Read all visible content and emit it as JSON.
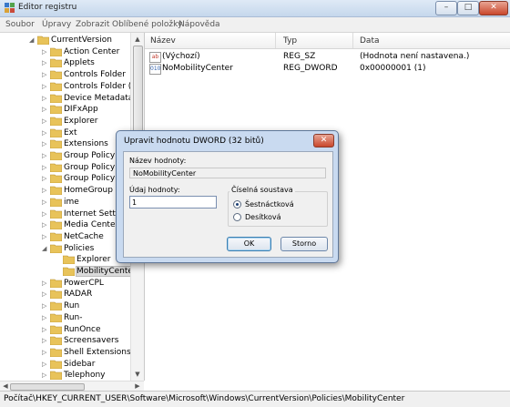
{
  "window": {
    "title": "Editor registru",
    "minimize": "–",
    "maximize": "□",
    "close": "✕"
  },
  "menu": [
    "Soubor",
    "Úpravy",
    "Zobrazit",
    "Oblíbené položky",
    "Nápověda"
  ],
  "tree": {
    "items": [
      {
        "label": "CurrentVersion",
        "expanded": true
      },
      {
        "label": "Action Center"
      },
      {
        "label": "Applets"
      },
      {
        "label": "Controls Folder"
      },
      {
        "label": "Controls Folder (Wo"
      },
      {
        "label": "Device Metadata"
      },
      {
        "label": "DIFxApp"
      },
      {
        "label": "Explorer"
      },
      {
        "label": "Ext"
      },
      {
        "label": "Extensions"
      },
      {
        "label": "Group Policy"
      },
      {
        "label": "Group Policy Ed"
      },
      {
        "label": "Group Policy Ob"
      },
      {
        "label": "HomeGroup"
      },
      {
        "label": "ime"
      },
      {
        "label": "Internet Settings"
      },
      {
        "label": "Media Center"
      },
      {
        "label": "NetCache"
      },
      {
        "label": "Policies",
        "expanded": true
      },
      {
        "label": "Explorer"
      },
      {
        "label": "MobilityCenter",
        "selected": true
      },
      {
        "label": "PowerCPL"
      },
      {
        "label": "RADAR"
      },
      {
        "label": "Run"
      },
      {
        "label": "Run-"
      },
      {
        "label": "RunOnce"
      },
      {
        "label": "Screensavers"
      },
      {
        "label": "Shell Extensions"
      },
      {
        "label": "Sidebar"
      },
      {
        "label": "Telephony"
      }
    ]
  },
  "list": {
    "columns": [
      "Název",
      "Typ",
      "Data"
    ],
    "rows": [
      {
        "icon": "string-value-icon",
        "icon_text": "ab",
        "name": "(Výchozí)",
        "type": "REG_SZ",
        "data": "(Hodnota není nastavena.)"
      },
      {
        "icon": "binary-value-icon",
        "icon_text": "010",
        "name": "NoMobilityCenter",
        "type": "REG_DWORD",
        "data": "0x00000001 (1)"
      }
    ]
  },
  "dialog": {
    "title": "Upravit hodnotu DWORD (32 bitů)",
    "close": "✕",
    "name_label": "Název hodnoty:",
    "name_value": "NoMobilityCenter",
    "data_label": "Údaj hodnoty:",
    "data_value": "1",
    "base_label": "Číselná soustava",
    "base_options": [
      "Šestnáctková",
      "Desítková"
    ],
    "base_selected": "Šestnáctková",
    "ok": "OK",
    "cancel": "Storno"
  },
  "status": {
    "path": "Počítač\\HKEY_CURRENT_USER\\Software\\Microsoft\\Windows\\CurrentVersion\\Policies\\MobilityCenter"
  },
  "colors": {
    "folder": "#e8c35a",
    "selection": "#dadada",
    "dialog_frame": "#c9daf0",
    "accent": "#3c7fb1"
  }
}
